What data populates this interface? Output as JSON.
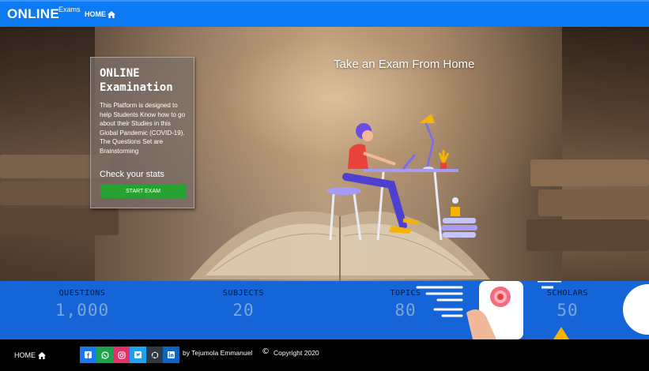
{
  "navbar": {
    "brand": "ONLINE",
    "brand_sub": "Exams",
    "home_label": "HOME",
    "home_icon": "home-icon"
  },
  "hero": {
    "tagline": "Take an Exam From Home",
    "card": {
      "title": "ONLINE Examination",
      "description": "This Platform is designed to help Students Know how to go about their Studies in this Global Pandemic (COVID-19). The Questions Set are Brainstorming",
      "stats_label": "Check your stats",
      "button_label": "START EXAM"
    }
  },
  "stats": [
    {
      "label": "QUESTIONS",
      "value": "1,000"
    },
    {
      "label": "SUBJECTS",
      "value": "20"
    },
    {
      "label": "TOPICS",
      "value": "80"
    },
    {
      "label": "SCHOLARS",
      "value": "50"
    }
  ],
  "footer": {
    "home_label": "HOME",
    "social": [
      {
        "name": "facebook-icon",
        "color": "#1877f2"
      },
      {
        "name": "whatsapp-icon",
        "color": "#1aa34a"
      },
      {
        "name": "instagram-icon",
        "color": "#e1306c"
      },
      {
        "name": "twitter-icon",
        "color": "#1da1f2"
      },
      {
        "name": "github-icon",
        "color": "#2f3a45"
      },
      {
        "name": "linkedin-icon",
        "color": "#0a66c2"
      }
    ],
    "credit": "by Tejumola Emmanuel",
    "copyright_symbol": "©",
    "copyright": "Copyright 2020"
  },
  "colors": {
    "navbar": "#0c7af2",
    "stats_bar": "#1565d8",
    "start_button": "#27a131"
  }
}
